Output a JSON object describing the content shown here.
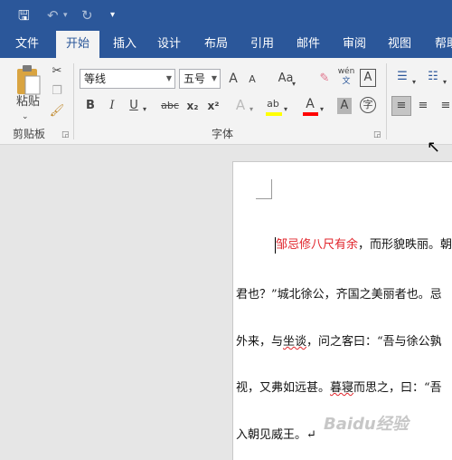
{
  "qat": {
    "save_icon": "save-icon",
    "undo_icon": "undo-icon",
    "redo_icon": "redo-icon",
    "customize_icon": "customize-qat-icon"
  },
  "tabs": [
    "文件",
    "开始",
    "插入",
    "设计",
    "布局",
    "引用",
    "邮件",
    "审阅",
    "视图",
    "帮助"
  ],
  "active_tab": "开始",
  "clipboard": {
    "paste_label": "粘贴",
    "group_label": "剪贴板"
  },
  "font": {
    "name": "等线",
    "size": "五号",
    "group_label": "字体",
    "grow_label": "A",
    "shrink_label": "A",
    "case_label": "Aa",
    "pinyin_label": "wén",
    "border_label": "A",
    "bold": "B",
    "italic": "I",
    "underline": "U",
    "strike": "abc",
    "subscript": "x₂",
    "superscript": "x²",
    "effects": "A",
    "highlight": "ab",
    "color": "A",
    "shade": "A",
    "enclose": "字"
  },
  "colors": {
    "brand": "#2b579a",
    "ribbon": "#f3f3f3",
    "red_text": "#e1242b",
    "highlight_yellow": "#ffff00",
    "font_color_red": "#ff0000"
  },
  "document": {
    "line1_red": "邹忌修八尺有余",
    "line1_rest": "，而形貌昳丽。朝",
    "line2": "君也？”城北徐公，齐国之美丽者也。忌",
    "line3_a": "外来，与",
    "line3_squig": "坐谈",
    "line3_b": "，问之客曰：“吾与徐公孰",
    "line4_a": "视，又弗如远甚。",
    "line4_squig": "暮寝",
    "line4_b": "而思之，曰：“吾",
    "line5": "入朝见威王。↵"
  },
  "watermark": "Baidu经验"
}
